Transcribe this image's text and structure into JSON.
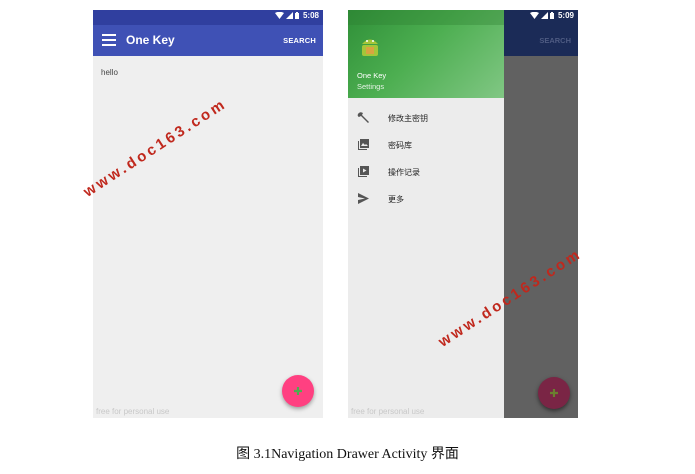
{
  "left_screen": {
    "status_time": "5:08",
    "app_title": "One Key",
    "search_label": "SEARCH",
    "content_text": "hello",
    "footnote": "free for personal use",
    "colors": {
      "appbar": "#3f51b5",
      "statusbar": "#303f9f",
      "fab": "#ff4081"
    }
  },
  "right_screen": {
    "status_time": "5:09",
    "search_label": "SEARCH",
    "drawer": {
      "app_name": "One Key",
      "subtitle": "Settings",
      "items": [
        {
          "label": "修改主密钥",
          "icon": "wrench-icon"
        },
        {
          "label": "密码库",
          "icon": "gallery-icon"
        },
        {
          "label": "操作记录",
          "icon": "play-list-icon"
        },
        {
          "label": "更多",
          "icon": "send-icon"
        }
      ]
    },
    "footnote": "free for personal use",
    "colors": {
      "drawer_header": "#4caf50",
      "scrim": "#616161",
      "fab": "#7a2545"
    }
  },
  "watermark": "www.doc163.com",
  "caption": "图 3.1Navigation Drawer Activity 界面"
}
